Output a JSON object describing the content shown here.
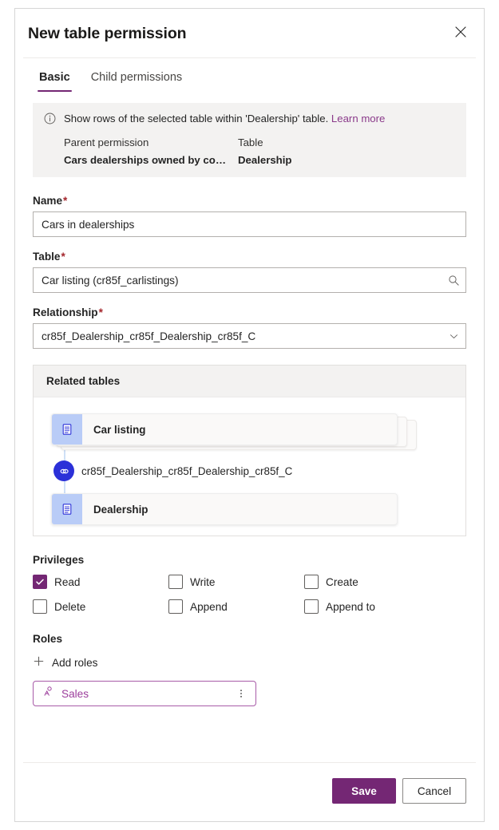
{
  "dialog": {
    "title": "New table permission",
    "close_icon": "close-icon"
  },
  "tabs": [
    {
      "label": "Basic",
      "active": true
    },
    {
      "label": "Child permissions",
      "active": false
    }
  ],
  "info_banner": {
    "icon": "info-circle-icon",
    "message": "Show rows of the selected table within 'Dealership' table.",
    "learn_more": "Learn more",
    "columns": [
      {
        "header": "Parent permission",
        "value": "Cars dealerships owned by compa..."
      },
      {
        "header": "Table",
        "value": "Dealership"
      }
    ]
  },
  "fields": {
    "name": {
      "label": "Name",
      "required": "*",
      "value": "Cars in dealerships",
      "placeholder": "Name"
    },
    "table": {
      "label": "Table",
      "required": "*",
      "value": "Car listing (cr85f_carlistings)",
      "placeholder": "Table",
      "affix_icon": "search-icon"
    },
    "relationship": {
      "label": "Relationship",
      "required": "*",
      "value": "cr85f_Dealership_cr85f_Dealership_cr85f_C",
      "placeholder": "Relationship",
      "affix_icon": "chevron-down-icon"
    }
  },
  "related_tables": {
    "header": "Related tables",
    "source_node": {
      "label": "Car listing",
      "icon": "table-icon",
      "stacked": true
    },
    "relationship_node": {
      "label": "cr85f_Dealership_cr85f_Dealership_cr85f_C",
      "icon": "link-icon"
    },
    "target_node": {
      "label": "Dealership",
      "icon": "table-icon",
      "stacked": false
    }
  },
  "privileges": {
    "label": "Privileges",
    "items": [
      {
        "label": "Read",
        "checked": true
      },
      {
        "label": "Write",
        "checked": false
      },
      {
        "label": "Create",
        "checked": false
      },
      {
        "label": "Delete",
        "checked": false
      },
      {
        "label": "Append",
        "checked": false
      },
      {
        "label": "Append to",
        "checked": false
      }
    ]
  },
  "roles": {
    "label": "Roles",
    "add_label": "Add roles",
    "add_icon": "plus-icon",
    "chips": [
      {
        "name": "Sales",
        "icon": "person-role-icon",
        "menu_icon": "more-vertical-icon"
      }
    ]
  },
  "footer": {
    "save_label": "Save",
    "cancel_label": "Cancel"
  },
  "colors": {
    "accent_purple": "#742774",
    "link_purple": "#8a3a8a",
    "chip_purple": "#9c3d9c",
    "required_red": "#a4262c",
    "node_icon_bg": "#b9ccf7",
    "relationship_blue": "#2b30d8",
    "banner_bg": "#f3f2f1"
  }
}
